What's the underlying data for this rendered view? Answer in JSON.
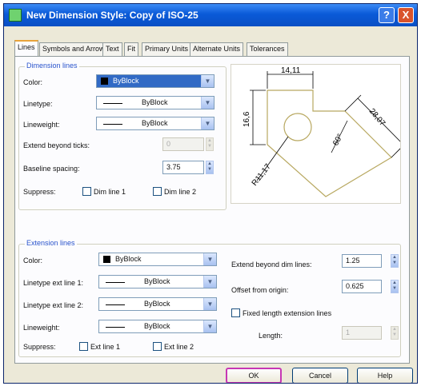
{
  "window": {
    "title": "New Dimension Style: Copy of ISO-25",
    "help_glyph": "?",
    "close_glyph": "X"
  },
  "tabs": [
    {
      "label": "Lines",
      "active": true
    },
    {
      "label": "Symbols and Arrows",
      "active": false
    },
    {
      "label": "Text",
      "active": false
    },
    {
      "label": "Fit",
      "active": false
    },
    {
      "label": "Primary Units",
      "active": false
    },
    {
      "label": "Alternate Units",
      "active": false
    },
    {
      "label": "Tolerances",
      "active": false
    }
  ],
  "dimension_lines": {
    "title": "Dimension lines",
    "color_label": "Color:",
    "color_value": "ByBlock",
    "linetype_label": "Linetype:",
    "linetype_value": "ByBlock",
    "lineweight_label": "Lineweight:",
    "lineweight_value": "ByBlock",
    "extend_label": "Extend beyond ticks:",
    "extend_value": "0",
    "baseline_label": "Baseline spacing:",
    "baseline_value": "3.75",
    "suppress_label": "Suppress:",
    "dim_line_1": "Dim line 1",
    "dim_line_2": "Dim line 2"
  },
  "preview": {
    "dim_top": "14,11",
    "dim_left": "16,6",
    "dim_right": "28,07",
    "dim_angle": "60°",
    "dim_radius": "R11,17"
  },
  "extension_lines": {
    "title": "Extension lines",
    "color_label": "Color:",
    "color_value": "ByBlock",
    "linetype1_label": "Linetype ext line 1:",
    "linetype1_value": "ByBlock",
    "linetype2_label": "Linetype ext line 2:",
    "linetype2_value": "ByBlock",
    "lineweight_label": "Lineweight:",
    "lineweight_value": "ByBlock",
    "suppress_label": "Suppress:",
    "ext_line_1": "Ext line 1",
    "ext_line_2": "Ext line 2",
    "extend_beyond_label": "Extend beyond dim lines:",
    "extend_beyond_value": "1.25",
    "offset_label": "Offset from origin:",
    "offset_value": "0.625",
    "fixed_length_label": "Fixed length extension lines",
    "length_label": "Length:",
    "length_value": "1"
  },
  "buttons": {
    "ok": "OK",
    "cancel": "Cancel",
    "help": "Help"
  },
  "colors": {
    "accent_title": "#2a54cc",
    "selection": "#316ac5",
    "ok_highlight": "#c637b4",
    "preview_geometry": "#b8a860"
  }
}
